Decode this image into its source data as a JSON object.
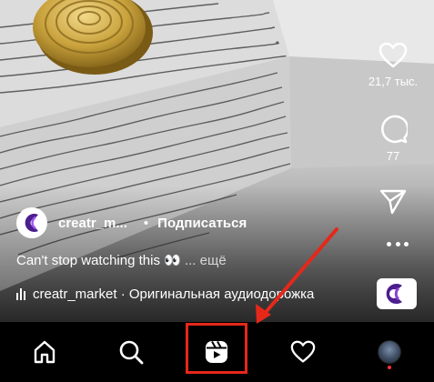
{
  "video": {
    "author": "creatr_m...",
    "follow_label": "Подписаться",
    "separator": "•",
    "caption": "Can't stop watching this 👀",
    "caption_more": "... ещё",
    "audio_text": "creatr_market · Оригинальная аудиодорожка"
  },
  "actions": {
    "like_count": "21,7 тыс.",
    "comment_count": "77"
  },
  "nav": {
    "items": [
      "home-icon",
      "search-icon",
      "reels-icon",
      "activity-heart-icon",
      "profile-avatar"
    ],
    "active": "reels-icon"
  },
  "annotation": {
    "color": "#e5281a"
  }
}
